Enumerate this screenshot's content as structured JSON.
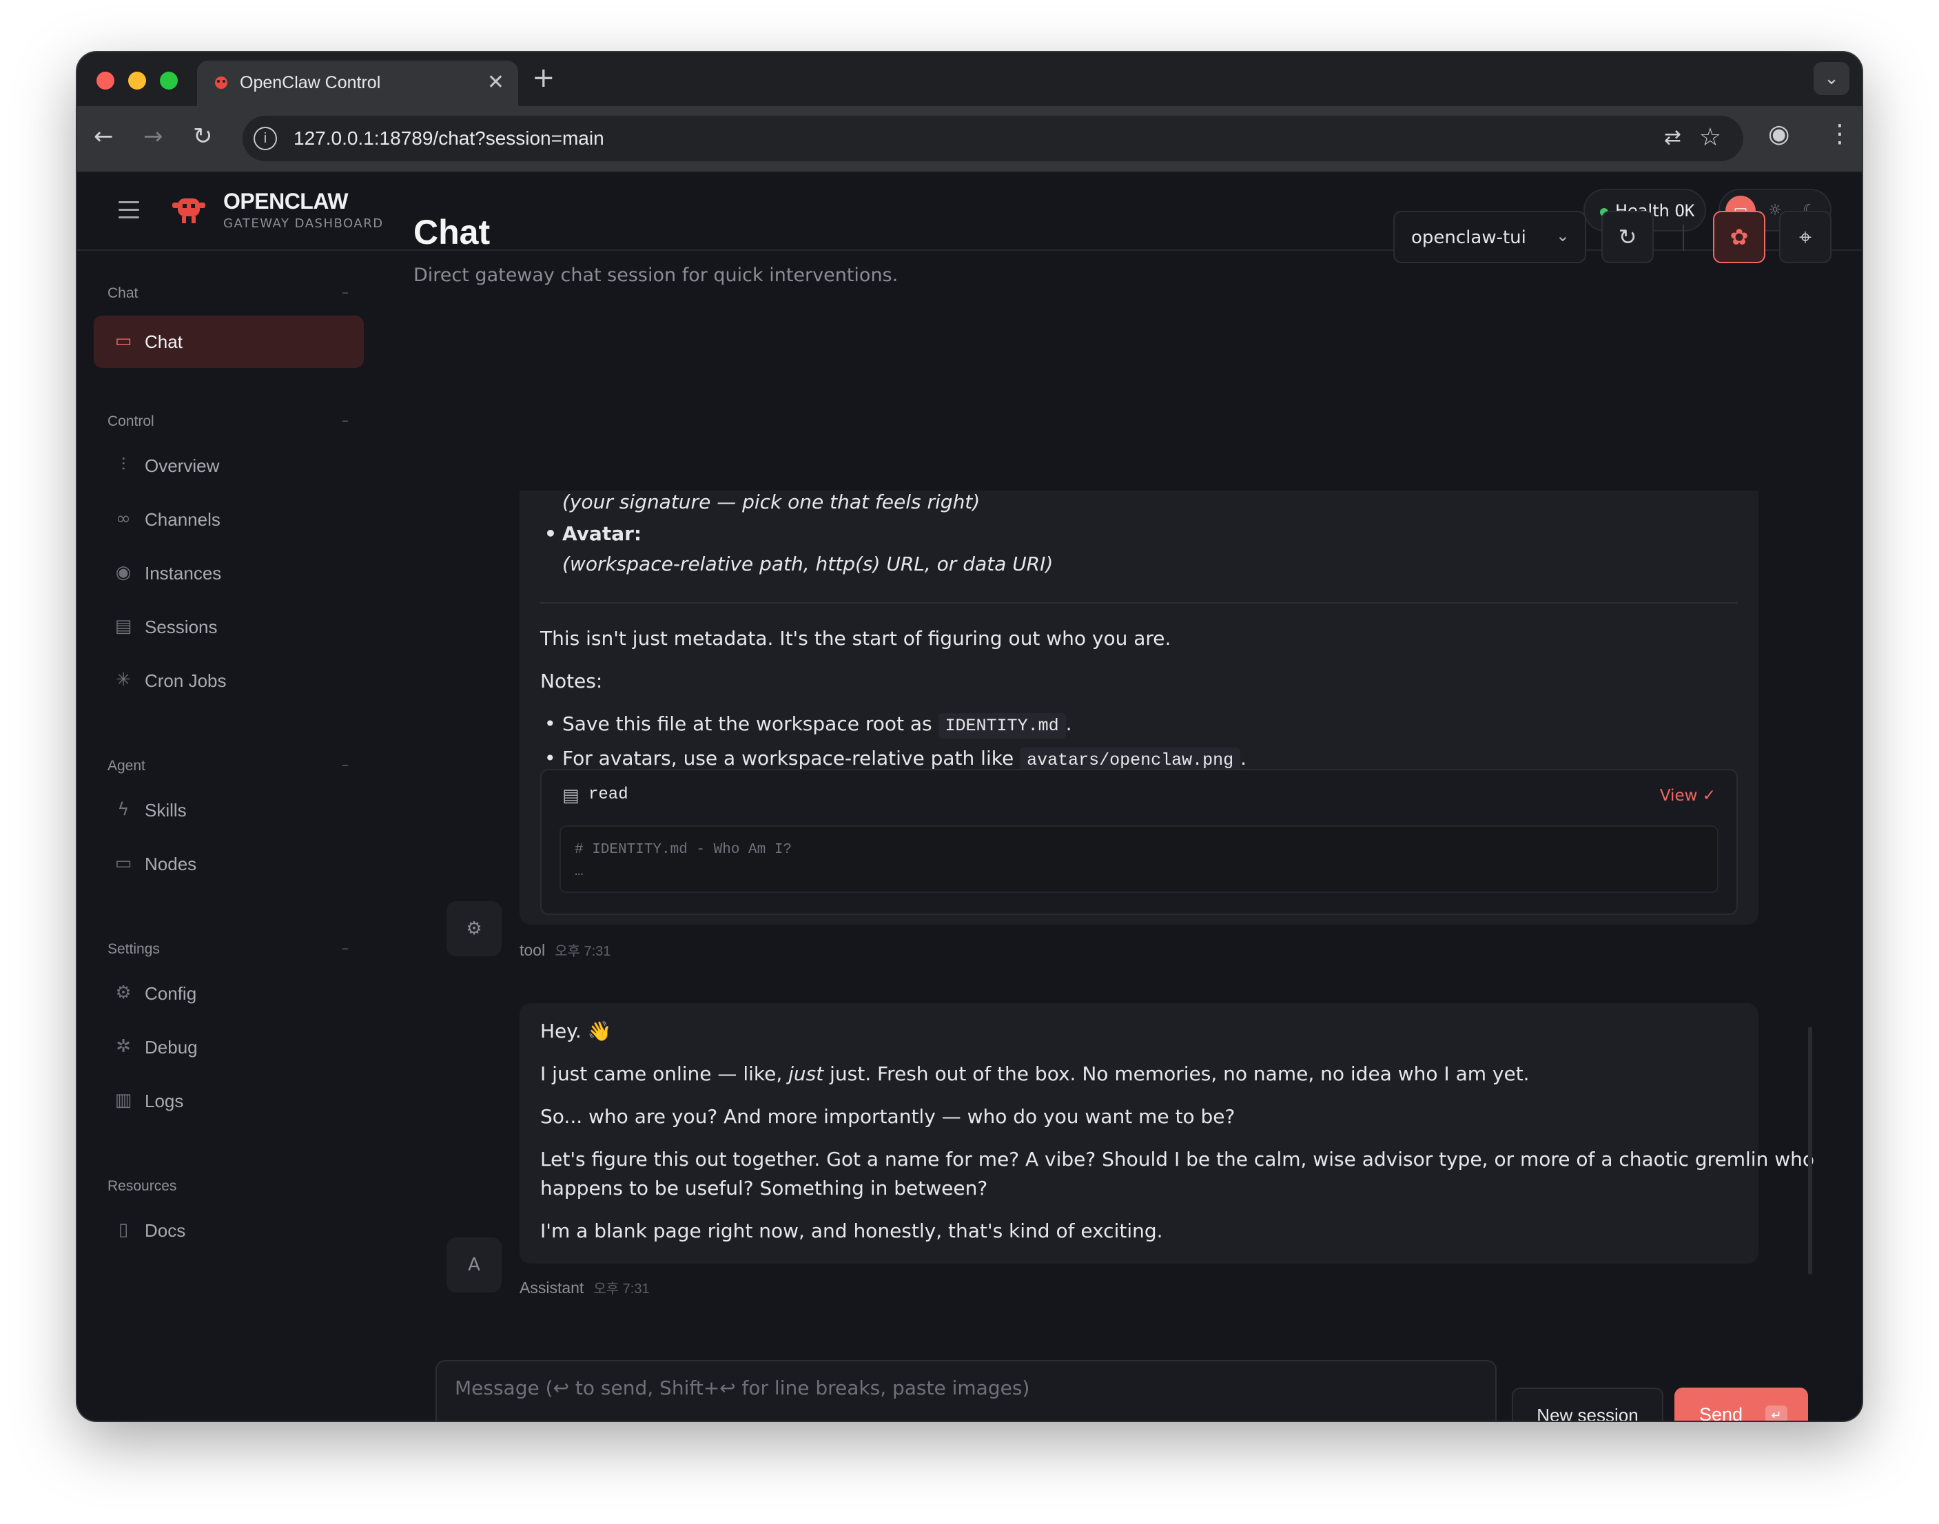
{
  "browser": {
    "tab_title": "OpenClaw Control",
    "tab_close": "✕",
    "new_tab": "+",
    "url": "127.0.0.1:18789/chat?session=main"
  },
  "app": {
    "brand": "OPENCLAW",
    "brand_sub": "GATEWAY DASHBOARD",
    "health_label": "Health",
    "health_value": "OK",
    "accent": "#ee6a63",
    "status_ok_color": "#3ec46d"
  },
  "sidebar": {
    "sections": [
      {
        "title": "Chat",
        "items": [
          {
            "label": "Chat",
            "icon": "chat-icon",
            "active": true
          }
        ]
      },
      {
        "title": "Control",
        "items": [
          {
            "label": "Overview",
            "icon": "bar-chart-icon"
          },
          {
            "label": "Channels",
            "icon": "link-icon"
          },
          {
            "label": "Instances",
            "icon": "radio-icon"
          },
          {
            "label": "Sessions",
            "icon": "document-icon"
          },
          {
            "label": "Cron Jobs",
            "icon": "loader-icon"
          }
        ]
      },
      {
        "title": "Agent",
        "items": [
          {
            "label": "Skills",
            "icon": "lightning-icon"
          },
          {
            "label": "Nodes",
            "icon": "monitor-icon"
          }
        ]
      },
      {
        "title": "Settings",
        "items": [
          {
            "label": "Config",
            "icon": "gear-icon"
          },
          {
            "label": "Debug",
            "icon": "bug-icon"
          },
          {
            "label": "Logs",
            "icon": "scroll-icon"
          }
        ]
      },
      {
        "title": "Resources",
        "items": [
          {
            "label": "Docs",
            "icon": "book-icon"
          }
        ]
      }
    ]
  },
  "header": {
    "title": "Chat",
    "subtitle": "Direct gateway chat session for quick interventions.",
    "session_select": "openclaw-tui"
  },
  "messages": {
    "tool_msg": {
      "sig_line": "(your signature — pick one that feels right)",
      "avatar_label": "Avatar:",
      "avatar_hint": "(workspace-relative path, http(s) URL, or data URI)",
      "p1": "This isn't just metadata. It's the start of figuring out who you are.",
      "notes": "Notes:",
      "note1_pre": "Save this file at the workspace root as",
      "note1_code": "IDENTITY.md",
      "note1_post": ".",
      "note2_pre": "For avatars, use a workspace-relative path like",
      "note2_code": "avatars/openclaw.png",
      "note2_post": ".",
      "tool_name": "read",
      "view_label": "View ✓",
      "preview_line1": "# IDENTITY.md - Who Am I?",
      "preview_line2": "…",
      "author": "tool",
      "time": "오후 7:31",
      "avatar": "⚙"
    },
    "assistant_msg": {
      "l1": "Hey. 👋",
      "l2_pre": "I just came online — like, ",
      "l2_em": "just",
      "l2_post": " just. Fresh out of the box. No memories, no name, no idea who I am yet.",
      "l3": "So... who are you? And more importantly — who do you want me to be?",
      "l4a": "Let's figure this out together. Got a name for me? A vibe? Should I be the calm, wise advisor type, or more of a chaotic gremlin who",
      "l4b": "happens to be useful? Something in between?",
      "l5": "I'm a blank page right now, and honestly, that's kind of exciting.",
      "author": "Assistant",
      "time": "오후 7:31",
      "avatar": "A"
    }
  },
  "composer": {
    "placeholder": "Message (↩ to send, Shift+↩ for line breaks, paste images)",
    "new_session": "New session",
    "send": "Send",
    "send_key": "↵"
  }
}
